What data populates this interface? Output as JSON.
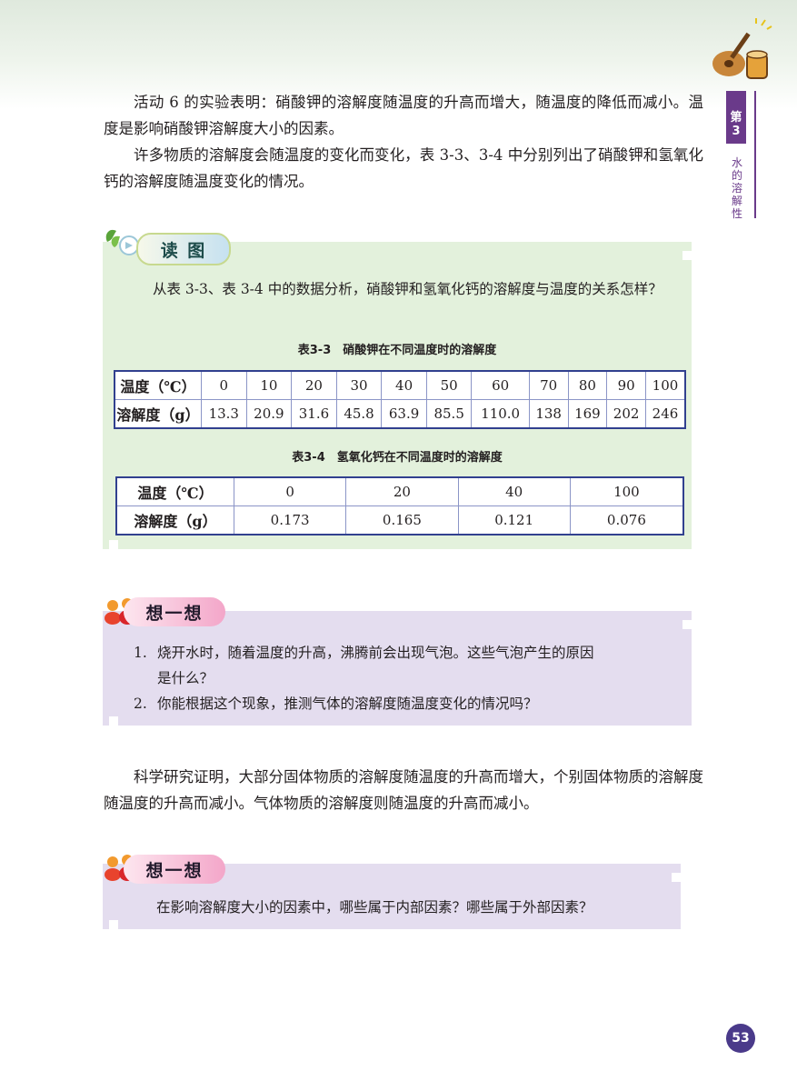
{
  "paragraphs": {
    "p1": "活动 6 的实验表明：硝酸钾的溶解度随温度的升高而增大，随温度的降低而减小。温度是影响硝酸钾溶解度大小的因素。",
    "p2": "许多物质的溶解度会随温度的变化而变化，表 3-3、3-4 中分别列出了硝酸钾和氢氧化钙的溶解度随温度变化的情况。",
    "p3": "科学研究证明，大部分固体物质的溶解度随温度的升高而增大，个别固体物质的溶解度随温度的升高而减小。气体物质的溶解度则随温度的升高而减小。"
  },
  "sidebar": {
    "chapter": "第3",
    "subtitle": "水的溶解性"
  },
  "read_figure": {
    "title": "读 图",
    "question": "从表 3-3、表 3-4 中的数据分析，硝酸钾和氢氧化钙的溶解度与温度的关系怎样？"
  },
  "table1": {
    "caption": "表3-3　硝酸钾在不同温度时的溶解度",
    "row_labels": [
      "温度（℃）",
      "溶解度（g）"
    ],
    "temps": [
      "0",
      "10",
      "20",
      "30",
      "40",
      "50",
      "60",
      "70",
      "80",
      "90",
      "100"
    ],
    "values": [
      "13.3",
      "20.9",
      "31.6",
      "45.8",
      "63.9",
      "85.5",
      "110.0",
      "138",
      "169",
      "202",
      "246"
    ]
  },
  "table2": {
    "caption": "表3-4　氢氧化钙在不同温度时的溶解度",
    "row_labels": [
      "温度（℃）",
      "溶解度（g）"
    ],
    "temps": [
      "0",
      "20",
      "40",
      "100"
    ],
    "values": [
      "0.173",
      "0.165",
      "0.121",
      "0.076"
    ]
  },
  "think1": {
    "title": "想一想",
    "items": [
      {
        "num": "1.",
        "text": "烧开水时，随着温度的升高，沸腾前会出现气泡。这些气泡产生的原因",
        "text2": "是什么？"
      },
      {
        "num": "2.",
        "text": "你能根据这个现象，推测气体的溶解度随温度变化的情况吗？"
      }
    ]
  },
  "think2": {
    "title": "想一想",
    "text": "在影响溶解度大小的因素中，哪些属于内部因素？哪些属于外部因素？"
  },
  "page_number": "53",
  "colors": {
    "green_box": "#e3f1dc",
    "purple_box": "#e4ddef",
    "table_border": "#31408f",
    "accent": "#6a3a8a"
  },
  "icons": [
    "leaf-book-icon",
    "guitar-drum-icon",
    "thinking-figures-icon"
  ]
}
